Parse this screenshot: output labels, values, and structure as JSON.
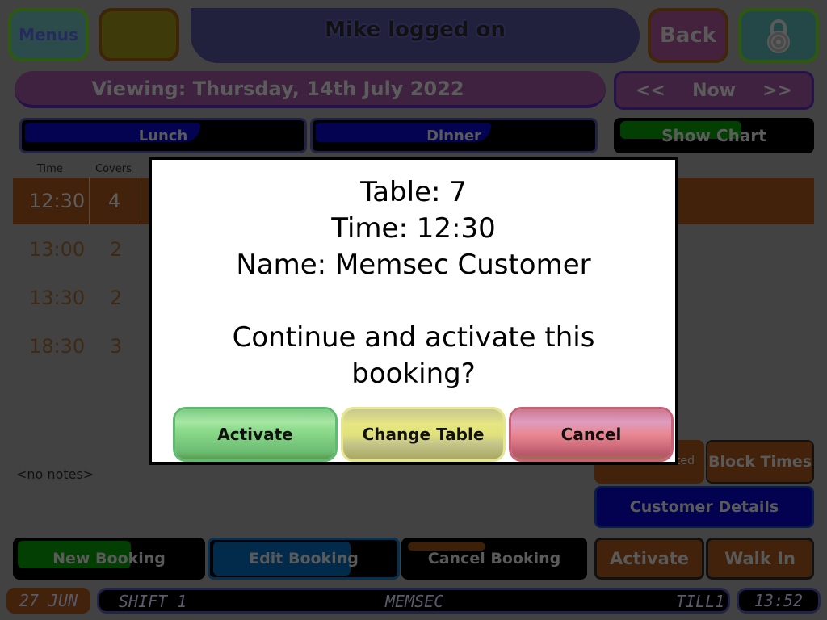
{
  "header": {
    "menus_label": "Menus",
    "logon_text": "Mike logged on",
    "back_label": "Back",
    "lock_icon": "padlock-icon"
  },
  "date_bar": {
    "viewing_text": "Viewing: Thursday, 14th July 2022"
  },
  "date_nav": {
    "prev_label": "<<",
    "now_label": "Now",
    "next_label": ">>"
  },
  "shifts": {
    "lunch_label": "Lunch",
    "dinner_label": "Dinner",
    "show_chart_label": "Show Chart"
  },
  "bookings_table": {
    "columns": [
      "Time",
      "Covers"
    ],
    "rows": [
      {
        "time": "12:30",
        "covers": "4",
        "selected": true
      },
      {
        "time": "13:00",
        "covers": "2"
      },
      {
        "time": "13:30",
        "covers": "2"
      },
      {
        "time": "18:30",
        "covers": "3"
      }
    ]
  },
  "notes": "<no notes>",
  "side_buttons": {
    "partially_hidden_label": "ted",
    "block_times_label": "Block Times",
    "customer_details_label": "Customer Details",
    "activate_label": "Activate",
    "walk_in_label": "Walk In"
  },
  "bottom_buttons": {
    "new_booking_label": "New Booking",
    "edit_booking_label": "Edit Booking",
    "cancel_booking_label": "Cancel Booking"
  },
  "status_bar": {
    "date": "27 JUN",
    "shift": "SHIFT 1",
    "site": "MEMSEC",
    "till": "TILL1",
    "clock": "13:52"
  },
  "dialog": {
    "table_line": "Table: 7",
    "time_line": "Time: 12:30",
    "name_line": "Name: Memsec Customer",
    "question_line1": "Continue and activate this",
    "question_line2": "booking?",
    "activate_label": "Activate",
    "change_table_label": "Change Table",
    "cancel_label": "Cancel"
  },
  "colors": {
    "dim_background": "#424242",
    "selected_row": "#42220a",
    "dialog_background": "#ffffff",
    "activate_green": "#8fdc8e",
    "change_table_yellow": "#e2e27c",
    "cancel_pink": "#de9cc0"
  }
}
